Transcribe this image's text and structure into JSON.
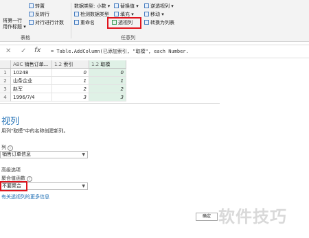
{
  "ribbon": {
    "left_col": {
      "line1": "将第一行",
      "line2": "用作标题 ▾"
    },
    "mid_col": {
      "transpose": "转置",
      "reverse": "反转行",
      "count": "对行进行计数"
    },
    "group_table": "表格",
    "type_label": "数据类型: 小数 ▾",
    "detect_type": "检测数据类型",
    "rename": "重命名",
    "replace": "替换值 ▾",
    "fill": "填充 ▾",
    "pivot": "透视列",
    "unpivot": "逆透视列 ▾",
    "move": "移动 ▾",
    "to_list": "转换为列表",
    "group_any": "任意列"
  },
  "formula_bar": {
    "cancel": "✕",
    "confirm": "✓",
    "fx": "fx",
    "formula": "= Table.AddColumn(已添加索引, \"取模\", each Number."
  },
  "table": {
    "headers": [
      {
        "icon": "ABC",
        "name": "销售订单..."
      },
      {
        "icon": "1.2",
        "name": "索引"
      },
      {
        "icon": "1.2",
        "name": "取模"
      }
    ],
    "rows": [
      {
        "n": "1",
        "a": "10248",
        "b": "0",
        "c": "0"
      },
      {
        "n": "2",
        "a": "山条企业",
        "b": "1",
        "c": "1"
      },
      {
        "n": "3",
        "a": "赵军",
        "b": "2",
        "c": "2"
      },
      {
        "n": "4",
        "a": "1996/7/4",
        "b": "3",
        "c": "3"
      }
    ]
  },
  "dialog": {
    "title": "视列",
    "description": "用列\"取模\"中的名称创建新列。",
    "value_label": "列",
    "value_select": "销售订单信息",
    "advanced": "高级选项",
    "agg_label": "聚合值函数",
    "agg_select": "不要聚合",
    "help_link": "有关透视列的更多信息",
    "ok": "确定"
  },
  "watermark": "软件技巧"
}
